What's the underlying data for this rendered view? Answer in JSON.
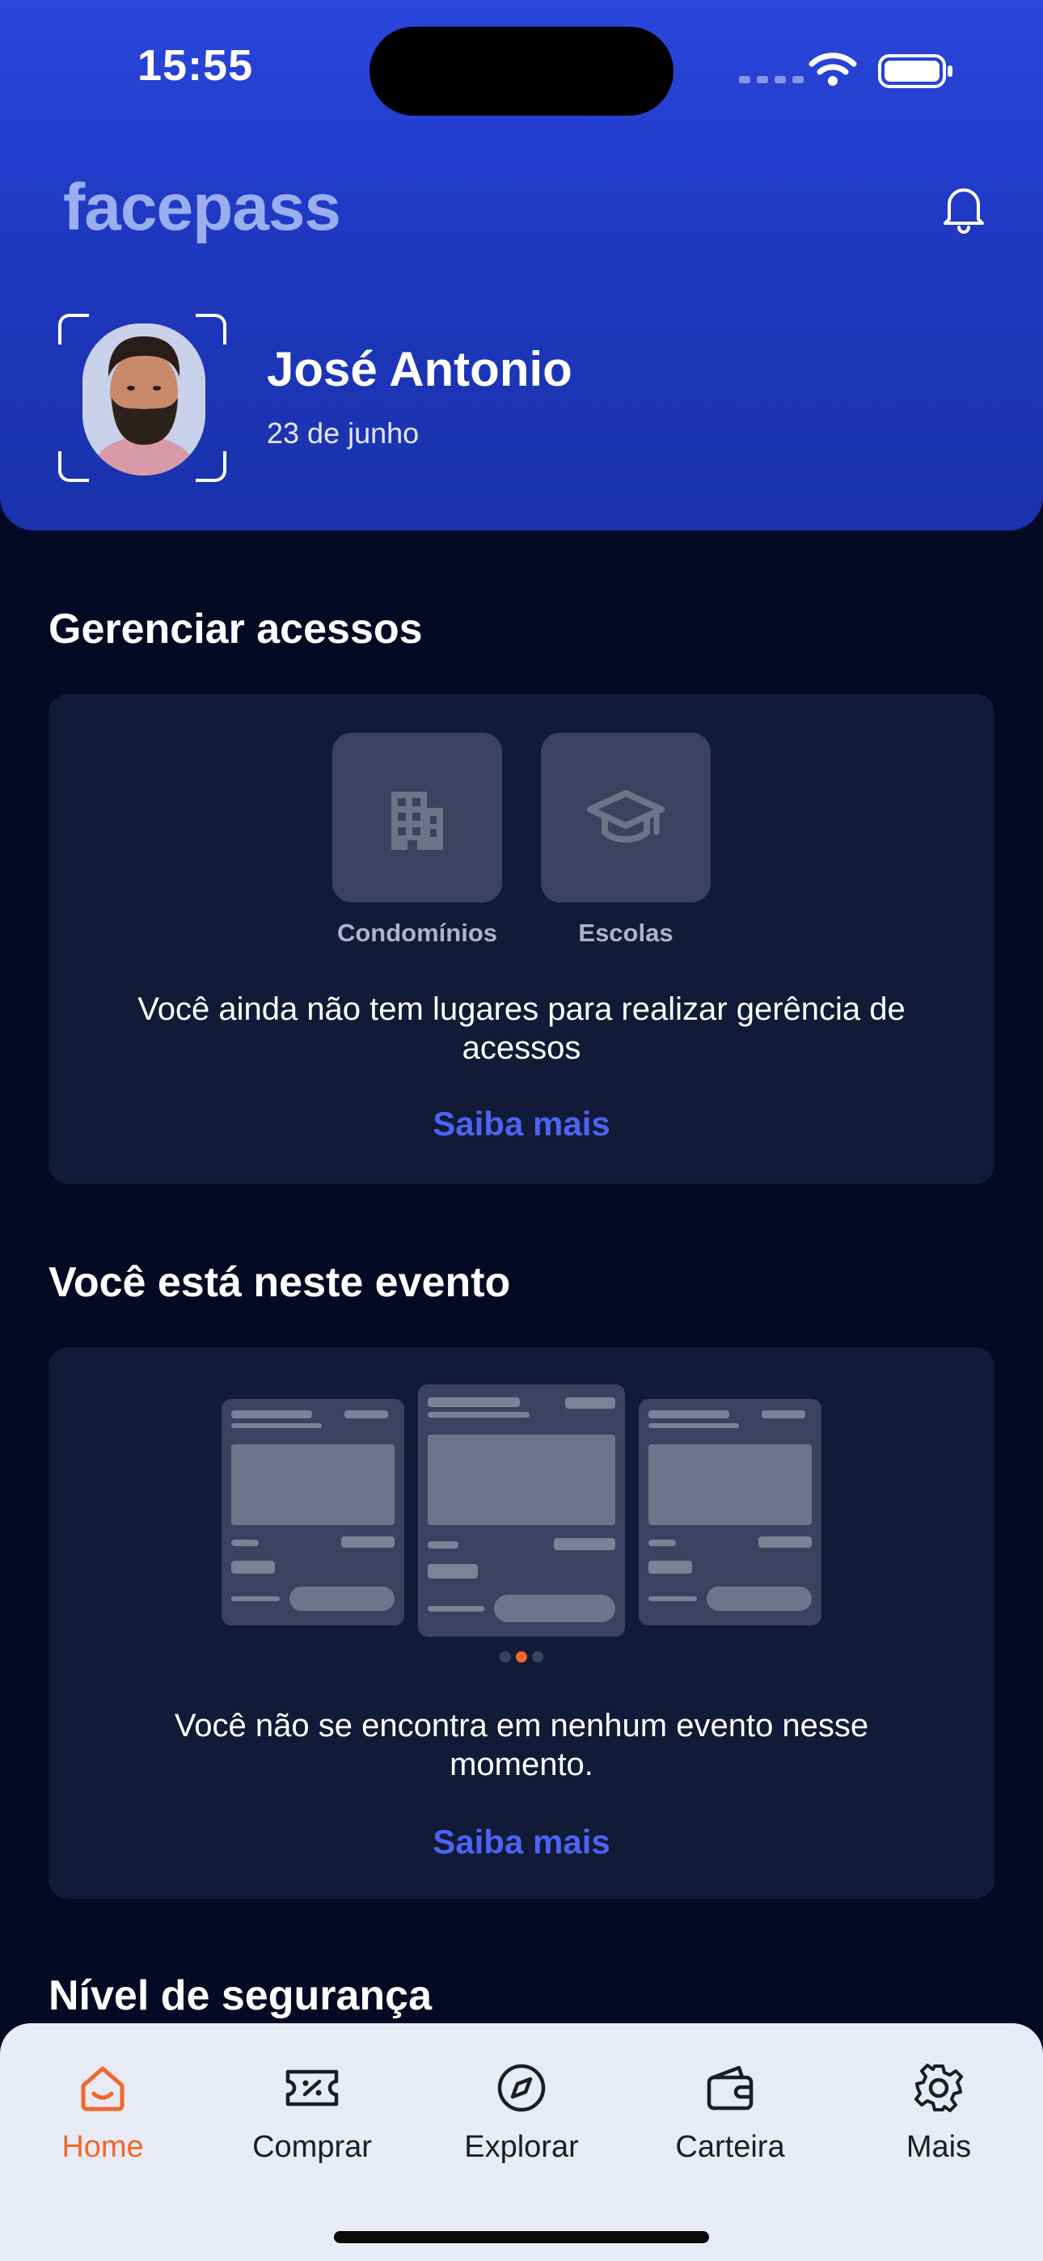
{
  "status_bar": {
    "time": "15:55"
  },
  "header": {
    "logo_text": "facepass",
    "user_name": "José Antonio",
    "user_date": "23 de junho"
  },
  "access": {
    "title": "Gerenciar acessos",
    "tiles": [
      {
        "label": "Condomínios",
        "icon": "building-icon"
      },
      {
        "label": "Escolas",
        "icon": "graduation-cap-icon"
      }
    ],
    "message": "Você ainda não tem lugares para realizar gerência de acessos",
    "link": "Saiba mais"
  },
  "event": {
    "title": "Você está neste evento",
    "message": "Você não se encontra em nenhum evento nesse momento.",
    "link": "Saiba mais",
    "carousel": {
      "active_index": 1,
      "count": 3
    }
  },
  "security": {
    "title": "Nível de segurança"
  },
  "tabbar": {
    "items": [
      {
        "label": "Home",
        "icon": "home-icon",
        "active": true
      },
      {
        "label": "Comprar",
        "icon": "ticket-icon",
        "active": false
      },
      {
        "label": "Explorar",
        "icon": "compass-icon",
        "active": false
      },
      {
        "label": "Carteira",
        "icon": "wallet-icon",
        "active": false
      },
      {
        "label": "Mais",
        "icon": "gear-icon",
        "active": false
      }
    ]
  },
  "colors": {
    "header_blue": "#2a47de",
    "background": "#050a24",
    "card": "#111a36",
    "link": "#4d63f2",
    "active_tab": "#f2672a"
  }
}
